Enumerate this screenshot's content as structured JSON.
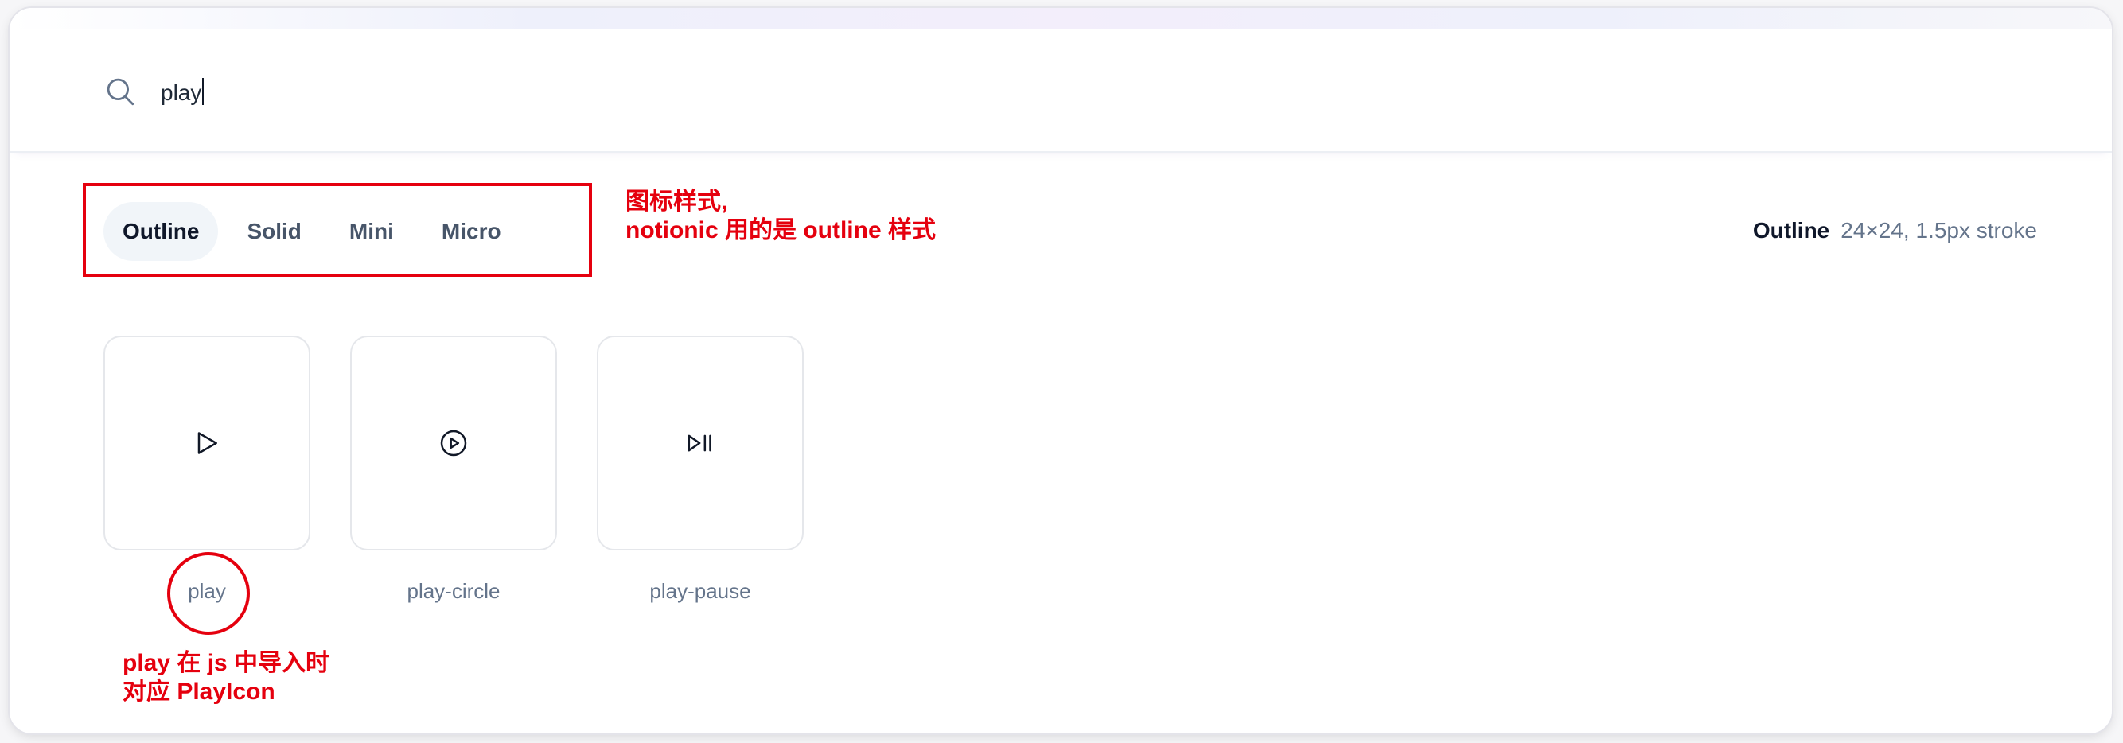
{
  "search": {
    "value": "play"
  },
  "style_tabs": [
    {
      "label": "Outline",
      "active": true
    },
    {
      "label": "Solid",
      "active": false
    },
    {
      "label": "Mini",
      "active": false
    },
    {
      "label": "Micro",
      "active": false
    }
  ],
  "style_info": {
    "name": "Outline",
    "detail": "24×24, 1.5px stroke"
  },
  "icons": [
    {
      "label": "play",
      "icon": "play-icon"
    },
    {
      "label": "play-circle",
      "icon": "play-circle-icon"
    },
    {
      "label": "play-pause",
      "icon": "play-pause-icon"
    }
  ],
  "annotations": {
    "style_note_line1": "图标样式,",
    "style_note_line2": "notionic 用的是 outline 样式",
    "import_note_line1": "play 在 js 中导入时",
    "import_note_line2": "对应 PlayIcon",
    "color": "#e5000e"
  }
}
